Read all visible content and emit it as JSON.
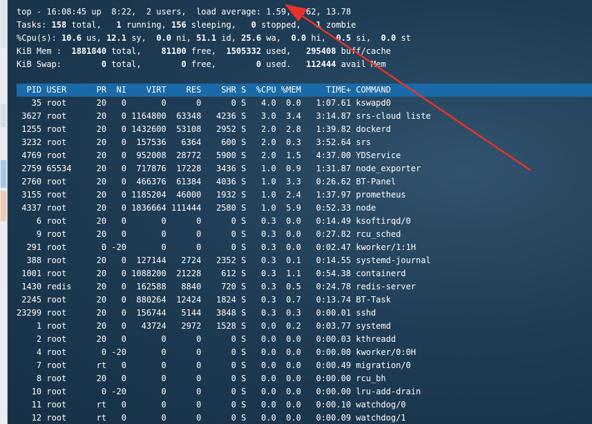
{
  "summary": {
    "line1": "top - 16:08:45 up  8:22,  2 users,  load average: 1.59, 9.62, 13.78",
    "tasks": {
      "label": "Tasks: ",
      "total": "158",
      "total_label": " total,   ",
      "running": "1",
      "running_label": " running, ",
      "sleeping": "156",
      "sleeping_label": " sleeping,   ",
      "stopped": "0",
      "stopped_label": " stopped,   ",
      "zombie": "1",
      "zombie_label": " zombie"
    },
    "cpu": {
      "label": "%Cpu(s): ",
      "us": "10.6",
      "us_label": " us, ",
      "sy": "12.1",
      "sy_label": " sy,  ",
      "ni": "0.0",
      "ni_label": " ni, ",
      "id": "51.1",
      "id_label": " id, ",
      "wa": "25.6",
      "wa_label": " wa,  ",
      "hi": "0.0",
      "hi_label": " hi,  ",
      "si": "0.5",
      "si_label": " si,  ",
      "st": "0.0",
      "st_label": " st"
    },
    "mem": {
      "label": "KiB Mem :  ",
      "total": "1881840",
      "total_label": " total,    ",
      "free": "81100",
      "free_label": " free,  ",
      "used": "1505332",
      "used_label": " used,   ",
      "cache": "295408",
      "cache_label": " buff/cache"
    },
    "swap": {
      "label": "KiB Swap:        ",
      "total": "0",
      "total_label": " total,        ",
      "free": "0",
      "free_label": " free,        ",
      "used": "0",
      "used_label": " used.   ",
      "avail": "112444",
      "avail_label": " avail Mem"
    }
  },
  "header": "  PID USER      PR  NI    VIRT    RES    SHR S  %CPU %MEM     TIME+ COMMAND",
  "processes": [
    "   35 root      20   0       0      0      0 S   4.0  0.0   1:07.61 kswapd0",
    " 3627 root      20   0 1164800  63348   4236 S   3.0  3.4   3:14.87 srs-cloud liste",
    " 1255 root      20   0 1432600  53108   2952 S   2.0  2.8   1:39.82 dockerd",
    " 3232 root      20   0  157536   6364    600 S   2.0  0.3   3:52.64 srs",
    " 4769 root      20   0  952008  28772   5900 S   2.0  1.5   4:37.00 YDService",
    " 2759 65534     20   0  717876  17228   3436 S   1.0  0.9   1:31.87 node_exporter",
    " 2760 root      20   0  466376  61384   4036 S   1.0  3.3   0:26.62 BT-Panel",
    " 3155 root      20   0 1185204  46000   1932 S   1.0  2.4   1:37.97 prometheus",
    " 4337 root      20   0 1836664 111444   2580 S   1.0  5.9   0:52.33 node",
    "    6 root      20   0       0      0      0 S   0.3  0.0   0:14.49 ksoftirqd/0",
    "    9 root      20   0       0      0      0 S   0.3  0.0   0:27.82 rcu_sched",
    "  291 root       0 -20       0      0      0 S   0.3  0.0   0:02.47 kworker/1:1H",
    "  388 root      20   0  127144   2724   2352 S   0.3  0.1   0:14.55 systemd-journal",
    " 1001 root      20   0 1088200  21228    612 S   0.3  1.1   0:54.38 containerd",
    " 1430 redis     20   0  162588   8840    720 S   0.3  0.5   0:24.78 redis-server",
    " 2245 root      20   0  880264  12424   1824 S   0.3  0.7   0:13.74 BT-Task",
    "23299 root      20   0  156744   5144   3848 S   0.3  0.3   0:00.01 sshd",
    "    1 root      20   0   43724   2972   1528 S   0.0  0.2   0:03.77 systemd",
    "    2 root      20   0       0      0      0 S   0.0  0.0   0:00.03 kthreadd",
    "    4 root       0 -20       0      0      0 S   0.0  0.0   0:00.00 kworker/0:0H",
    "    7 root      rt   0       0      0      0 S   0.0  0.0   0:00.49 migration/0",
    "    8 root      20   0       0      0      0 S   0.0  0.0   0:00.00 rcu_bh",
    "   10 root       0 -20       0      0      0 S   0.0  0.0   0:00.00 lru-add-drain",
    "   11 root      rt   0       0      0      0 S   0.0  0.0   0:00.10 watchdog/0",
    "   12 root      rt   0       0      0      0 S   0.0  0.0   0:00.09 watchdog/1"
  ],
  "colors": {
    "terminal_bg": "#1f3d56",
    "header_bar": "#1a6aa8",
    "text": "#ffffff",
    "annotation_arrow": "#e8322b"
  }
}
